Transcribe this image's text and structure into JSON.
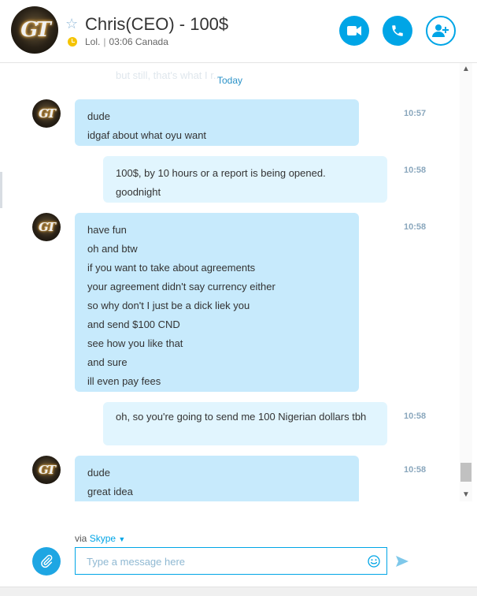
{
  "header": {
    "title": "Chris(CEO) - 100$",
    "status_text": "Lol.",
    "local_time": "03:06 Canada",
    "avatar_monogram": "GT",
    "icons": {
      "favorite": "star-icon",
      "status": "clock-icon",
      "video": "video-camera-icon",
      "call": "phone-icon",
      "add": "add-person-icon"
    }
  },
  "chat": {
    "ghost_text": "but still, that's what I r...",
    "date_divider": "Today",
    "avatar_monogram": "GT",
    "messages": [
      {
        "direction": "in",
        "time": "10:57",
        "lines": [
          "dude",
          "idgaf about what oyu want"
        ]
      },
      {
        "direction": "out",
        "time": "10:58",
        "lines": [
          "100$, by 10 hours or a report is being opened.",
          "goodnight"
        ]
      },
      {
        "direction": "in",
        "time": "10:58",
        "lines": [
          "have fun",
          "oh and btw",
          "if you want to take about agreements",
          "your agreement didn't say currency either",
          "so why don't I just be a dick liek you",
          "and send $100 CND",
          "see how you like that",
          "and sure",
          "ill even pay fees"
        ]
      },
      {
        "direction": "out",
        "time": "10:58",
        "lines": [
          "oh, so you're going to send me 100 Nigerian dollars tbh"
        ]
      },
      {
        "direction": "in",
        "time": "10:58",
        "lines": [
          "dude",
          "great idea"
        ]
      }
    ]
  },
  "composer": {
    "via_label": "via",
    "via_service": "Skype",
    "placeholder": "Type a message here",
    "icons": {
      "attach": "paperclip-icon",
      "emoji": "smiley-icon",
      "send": "send-icon"
    }
  },
  "colors": {
    "accent": "#00a5e6",
    "incoming_bubble": "#c7eafc",
    "outgoing_bubble": "#e1f5fe",
    "timestamp": "#8aa7bd",
    "status_away": "#f5c400"
  }
}
